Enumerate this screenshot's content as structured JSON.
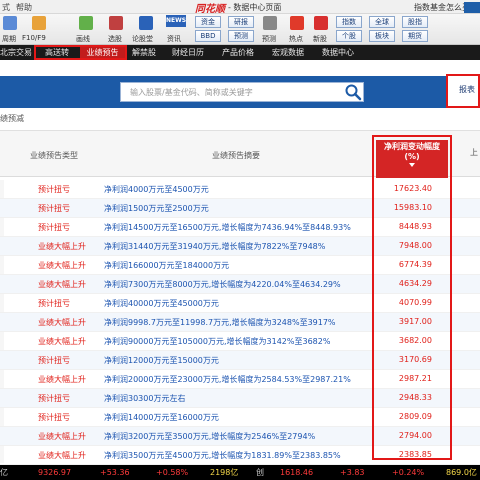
{
  "titlebar": {
    "menu": [
      "式",
      "帮助"
    ],
    "logo": "同花顺",
    "title": "- 数据中心页面",
    "help": "指数基金怎么买?"
  },
  "toolbar": {
    "items": [
      "周期",
      "F10/F9",
      "画线",
      "选股",
      "论股堂",
      "资讯",
      "预测",
      "热点",
      "新股"
    ],
    "boxes_top": [
      "资金",
      "研报",
      "指数",
      "全球",
      "股指"
    ],
    "boxes_bottom": [
      "BBD",
      "预测",
      "个股",
      "板块",
      "期货"
    ],
    "news_label": "NEWS"
  },
  "tabs": {
    "items": [
      "北宗交易",
      "高送转",
      "业绩预告",
      "解禁股",
      "财经日历",
      "产品价格",
      "宏观数据",
      "数据中心"
    ],
    "active": "业绩预告"
  },
  "search": {
    "placeholder": "输入股票/基金代码、简称或关键字",
    "report_label": "报表"
  },
  "subtitle": "绩预减",
  "table": {
    "headers": {
      "type": "业绩预告类型",
      "summary": "业绩预告摘要",
      "change": "净利润变动幅度",
      "change_unit": "(%)",
      "extra": "上"
    },
    "rows": [
      {
        "type": "预计扭亏",
        "summary": "净利润4000万元至4500万元",
        "value": "17623.40"
      },
      {
        "type": "预计扭亏",
        "summary": "净利润1500万元至2500万元",
        "value": "15983.10"
      },
      {
        "type": "预计扭亏",
        "summary": "净利润14500万元至16500万元,增长幅度为7436.94%至8448.93%",
        "value": "8448.93"
      },
      {
        "type": "业绩大幅上升",
        "summary": "净利润31440万元至31940万元,增长幅度为7822%至7948%",
        "value": "7948.00"
      },
      {
        "type": "业绩大幅上升",
        "summary": "净利润166000万元至184000万元",
        "value": "6774.39"
      },
      {
        "type": "业绩大幅上升",
        "summary": "净利润7300万元至8000万元,增长幅度为4220.04%至4634.29%",
        "value": "4634.29"
      },
      {
        "type": "预计扭亏",
        "summary": "净利润40000万元至45000万元",
        "value": "4070.99"
      },
      {
        "type": "业绩大幅上升",
        "summary": "净利润9998.7万元至11998.7万元,增长幅度为3248%至3917%",
        "value": "3917.00"
      },
      {
        "type": "业绩大幅上升",
        "summary": "净利润90000万元至105000万元,增长幅度为3142%至3682%",
        "value": "3682.00"
      },
      {
        "type": "预计扭亏",
        "summary": "净利润12000万元至15000万元",
        "value": "3170.69"
      },
      {
        "type": "业绩大幅上升",
        "summary": "净利润20000万元至23000万元,增长幅度为2584.53%至2987.21%",
        "value": "2987.21"
      },
      {
        "type": "预计扭亏",
        "summary": "净利润30300万元左右",
        "value": "2948.33"
      },
      {
        "type": "预计扭亏",
        "summary": "净利润14000万元至16000万元",
        "value": "2809.09"
      },
      {
        "type": "业绩大幅上升",
        "summary": "净利润3200万元至3500万元,增长幅度为2546%至2794%",
        "value": "2794.00"
      },
      {
        "type": "业绩大幅上升",
        "summary": "净利润3500万元至4500万元,增长幅度为1831.89%至2383.85%",
        "value": "2383.85"
      }
    ]
  },
  "statusbar": {
    "left_label": "亿",
    "index1": "9326.97",
    "change1": "+53.36",
    "pct1": "+0.58%",
    "amount1": "2198亿",
    "label2": "创",
    "index2": "1618.46",
    "change2": "+3.83",
    "pct2": "+0.24%",
    "amount2": "869.0亿"
  },
  "colors": {
    "accent_red": "#d42525",
    "link_blue": "#1c54b0",
    "search_blue": "#1c5aa6",
    "up_red": "#ff3b3b",
    "status_yellow": "#f5d84a"
  }
}
